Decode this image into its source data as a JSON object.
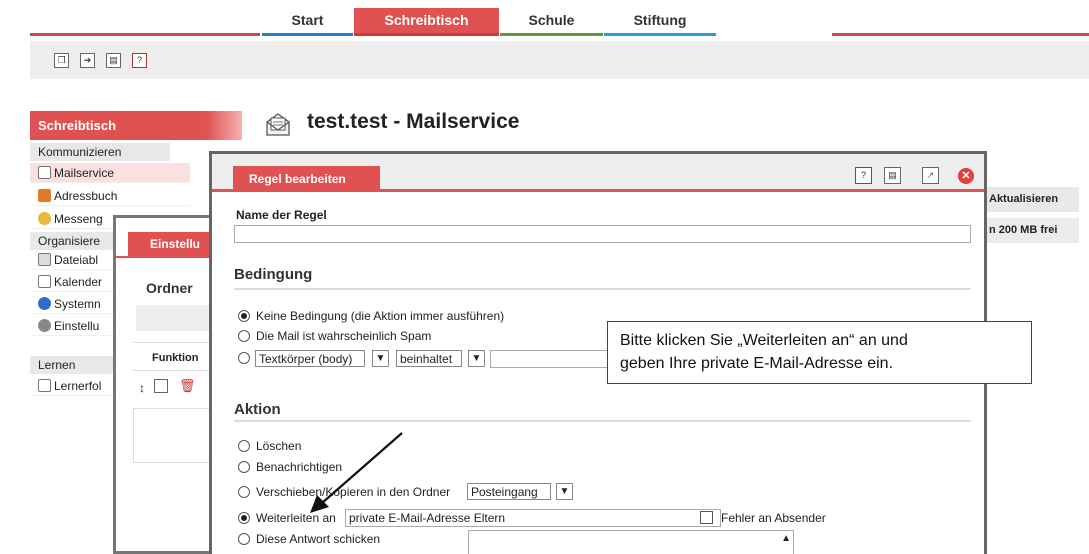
{
  "nav": {
    "tabs": [
      {
        "label": "Start",
        "color": "#2a7fc9"
      },
      {
        "label": "Schreibtisch",
        "color": "#e05252"
      },
      {
        "label": "Schule",
        "color": "#5aa02c"
      },
      {
        "label": "Stiftung",
        "color": "#2a9fd6"
      }
    ],
    "active_tab": "Schreibtisch"
  },
  "toolbar": {
    "icons": [
      "windows-icon",
      "login-icon",
      "print-icon",
      "help-icon"
    ]
  },
  "sidebar": {
    "header": "Schreibtisch",
    "groups": {
      "kommunizieren": "Kommunizieren",
      "organisieren": "Organisiere",
      "lernen": "Lernen"
    },
    "items": {
      "mailservice": "Mailservice",
      "adressbuch": "Adressbuch",
      "messenger": "Messeng",
      "dateiablage": "Dateiabl",
      "kalender": "Kalender",
      "systemnachrichten": "Systemn",
      "einstellungen": "Einstellu",
      "lernerfolg": "Lernerfol"
    }
  },
  "page": {
    "title": "test.test - Mailservice"
  },
  "background_buttons": {
    "aktualisieren": "Aktualisieren",
    "quota": "n 200 MB frei"
  },
  "settings_window": {
    "tab": "Einstellu",
    "ordner": "Ordner",
    "funktion_header": "Funktion"
  },
  "dialog": {
    "tab": "Regel bearbeiten",
    "name_label": "Name der Regel",
    "name_value": "",
    "bedingung_title": "Bedingung",
    "bedingung": {
      "opt_keine": "Keine Bedingung (die Aktion immer ausführen)",
      "opt_spam": "Die Mail ist wahrscheinlich Spam",
      "field_select": "Textkörper (body)",
      "operator_select": "beinhaltet",
      "selected": "keine"
    },
    "aktion_title": "Aktion",
    "aktion": {
      "opt_loeschen": "Löschen",
      "opt_benachrichtigen": "Benachrichtigen",
      "opt_verschieben": "Verschieben/Kopieren in den Ordner",
      "ordner_select": "Posteingang",
      "opt_weiterleiten": "Weiterleiten an",
      "weiterleiten_value": "private E-Mail-Adresse Eltern",
      "fehler_label": "Fehler an Absender",
      "fehler_checked": false,
      "opt_antwort": "Diese Antwort schicken",
      "selected": "weiterleiten"
    }
  },
  "annotation": {
    "line1": "Bitte klicken Sie „Weiterleiten an“ an und",
    "line2": "geben Ihre private E-Mail-Adresse ein."
  },
  "colors": {
    "accent": "#e05252",
    "toolbar_bg": "#eeeeee",
    "border": "#666666"
  }
}
